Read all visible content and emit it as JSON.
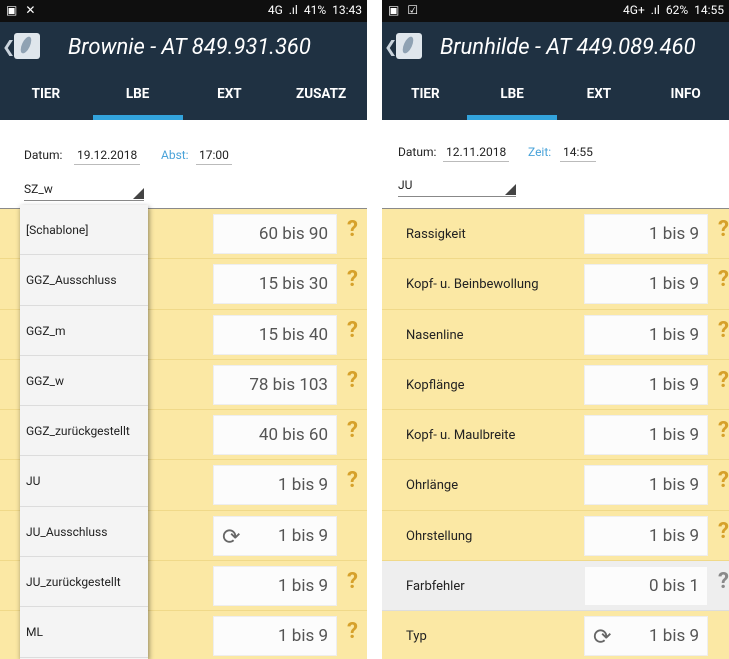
{
  "left": {
    "status": {
      "left_icons": [
        "▣",
        "✕"
      ],
      "network": "4G",
      "battery": "41%",
      "time": "13:43"
    },
    "appbar": {
      "back": "❮",
      "title": "Brownie - AT 849.931.360"
    },
    "tabs": [
      "TIER",
      "LBE",
      "EXT",
      "ZUSATZ"
    ],
    "form": {
      "date_label": "Datum:",
      "date_value": "19.12.2018",
      "time_label": "Abst:",
      "time_value": "17:00",
      "select_value": "SZ_w"
    },
    "dropdown": [
      "[Schablone]",
      "GGZ_Ausschluss",
      "GGZ_m",
      "GGZ_w",
      "GGZ_zurückgestellt",
      "JU",
      "JU_Ausschluss",
      "JU_zurückgestellt",
      "ML"
    ],
    "rows": [
      {
        "value": "60 bis 90",
        "help": "?"
      },
      {
        "value": "15 bis 30",
        "help": "?"
      },
      {
        "value": "15 bis 40",
        "help": "?"
      },
      {
        "value": "78 bis 103",
        "help": "?"
      },
      {
        "value": "40 bis 60",
        "help": "?"
      },
      {
        "value": "1 bis 9",
        "help": "?"
      },
      {
        "value": "1 bis 9",
        "help": "",
        "sync": "⟳"
      },
      {
        "value": "1 bis 9",
        "help": "?"
      },
      {
        "value": "1 bis 9",
        "help": "?"
      }
    ]
  },
  "right": {
    "status": {
      "left_icons": [
        "▣",
        "☑"
      ],
      "network": "4G+",
      "battery": "62%",
      "time": "14:55"
    },
    "appbar": {
      "back": "❮",
      "title": "Brunhilde - AT 449.089.460"
    },
    "tabs": [
      "TIER",
      "LBE",
      "EXT",
      "INFO"
    ],
    "form": {
      "date_label": "Datum:",
      "date_value": "12.11.2018",
      "time_label": "Zeit:",
      "time_value": "14:55",
      "select_value": "JU"
    },
    "rows": [
      {
        "label": "Rassigkeit",
        "value": "1 bis 9",
        "help": "?"
      },
      {
        "label": "Kopf- u. Beinbewollung",
        "value": "1 bis 9",
        "help": "?"
      },
      {
        "label": "Nasenline",
        "value": "1 bis 9",
        "help": "?"
      },
      {
        "label": "Kopflänge",
        "value": "1 bis 9",
        "help": "?"
      },
      {
        "label": "Kopf- u. Maulbreite",
        "value": "1 bis 9",
        "help": "?"
      },
      {
        "label": "Ohrlänge",
        "value": "1 bis 9",
        "help": "?"
      },
      {
        "label": "Ohrstellung",
        "value": "1 bis 9",
        "help": "?"
      },
      {
        "label": "Farbfehler",
        "value": "0 bis 1",
        "help": "?",
        "gray": true
      },
      {
        "label": "Typ",
        "value": "1 bis 9",
        "help": "",
        "sync": "⟳"
      }
    ]
  }
}
